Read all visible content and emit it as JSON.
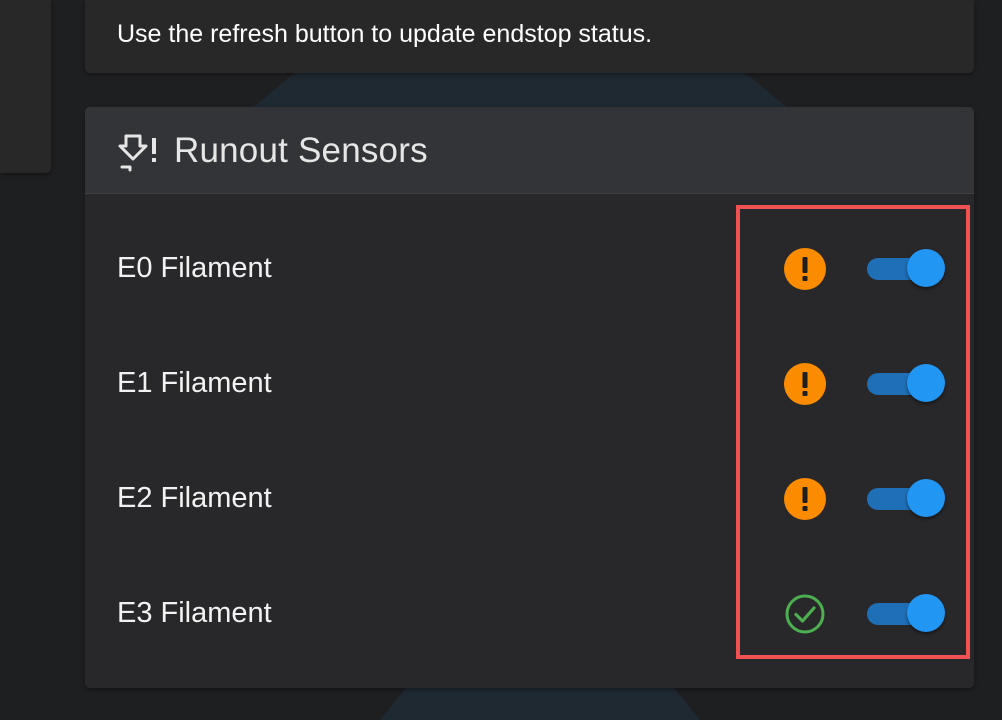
{
  "info_text": "Use the refresh button to update endstop status.",
  "runout_card": {
    "title": "Runout Sensors",
    "icon": "runout-sensor-icon"
  },
  "sensors": [
    {
      "label": "E0 Filament",
      "status": "warning",
      "status_icon": "alert-circle-icon",
      "enabled": true
    },
    {
      "label": "E1 Filament",
      "status": "warning",
      "status_icon": "alert-circle-icon",
      "enabled": true
    },
    {
      "label": "E2 Filament",
      "status": "warning",
      "status_icon": "alert-circle-icon",
      "enabled": true
    },
    {
      "label": "E3 Filament",
      "status": "ok",
      "status_icon": "check-circle-icon",
      "enabled": true
    }
  ],
  "colors": {
    "warning": "#fb8c00",
    "ok": "#4caf50",
    "toggle_on": "#2196f3",
    "highlight": "#f05252"
  }
}
